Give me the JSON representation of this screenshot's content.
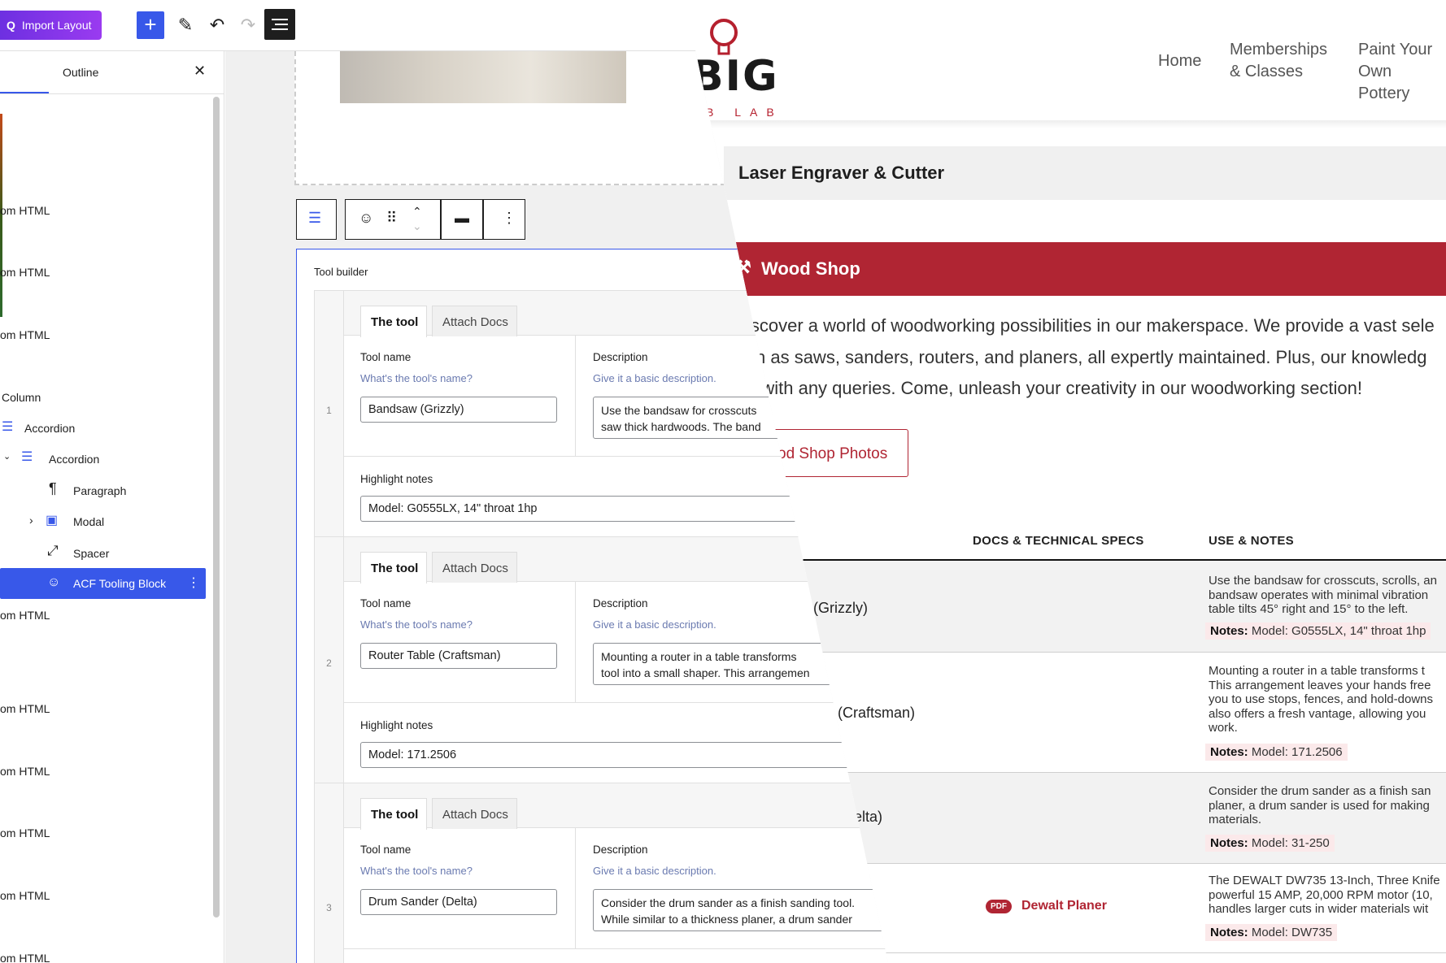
{
  "site": {
    "logo_text": "BIG",
    "logo_sub": "B LAB",
    "nav": [
      {
        "label": "Home"
      },
      {
        "label": "Memberships & Classes",
        "line1": "Memberships",
        "line2": "& Classes"
      },
      {
        "label": "Paint Your Own Pottery",
        "line1": "Paint Your",
        "line2": "Own Pottery"
      }
    ],
    "laser_title": "Laser Engraver & Cutter",
    "wood_title": "Wood Shop",
    "intro_lines": [
      "iscover a world of woodworking possibilities in our makerspace. We provide a vast sele",
      "ch as saws, sanders, routers, and planers, all expertly maintained. Plus, our knowledg",
      "o with any queries. Come, unleash your creativity in our woodworking section!"
    ],
    "photos_button": "od Shop Photos",
    "table": {
      "headers": {
        "docs": "DOCS & TECHNICAL SPECS",
        "use": "USE & NOTES"
      },
      "notes_label": "Notes:",
      "rows": [
        {
          "name": "(Grizzly)",
          "use": [
            "Use the bandsaw for crosscuts, scrolls, an",
            "bandsaw operates with minimal vibration",
            "table tilts 45° right and 15° to the left."
          ],
          "note": "Model: G0555LX, 14\" throat 1hp"
        },
        {
          "name": "(Craftsman)",
          "use": [
            "Mounting a router in a table transforms t",
            "This arrangement leaves your hands free",
            "you to use stops, fences, and hold-downs",
            "also offers a fresh vantage, allowing you",
            "work."
          ],
          "note": "Model: 171.2506"
        },
        {
          "name": "elta)",
          "use": [
            "Consider the drum sander as a finish san",
            "planer, a drum sander is used for making",
            "materials."
          ],
          "note": "Model: 31-250"
        },
        {
          "name": "",
          "doc_badge": "PDF",
          "doc_link": "Dewalt Planer",
          "use": [
            "The DEWALT DW735 13-Inch, Three Knife",
            "powerful 15 AMP, 20,000 RPM motor (10,",
            "handles larger cuts in wider materials wit"
          ],
          "note": "Model: DW735"
        }
      ]
    }
  },
  "editor": {
    "toolbar": {
      "import_label": "Import Layout",
      "import_icon": "Q",
      "add_icon": "+",
      "edit_icon": "✎",
      "undo_icon": "↶",
      "redo_icon": "↷"
    },
    "outline": {
      "title": "Outline",
      "close_icon": "✕",
      "items": [
        {
          "label": "om HTML"
        },
        {
          "label": "om HTML"
        },
        {
          "label": "om HTML"
        },
        {
          "label": "Column"
        },
        {
          "label": "Accordion"
        },
        {
          "label": "Accordion"
        },
        {
          "label": "Paragraph"
        },
        {
          "label": "Modal"
        },
        {
          "label": "Spacer"
        },
        {
          "label": "ACF Tooling Block"
        },
        {
          "label": "om HTML"
        },
        {
          "label": "om HTML"
        },
        {
          "label": "om HTML"
        },
        {
          "label": "om HTML"
        },
        {
          "label": "om HTML"
        },
        {
          "label": "om HTML"
        }
      ]
    },
    "block": {
      "title": "Tool builder",
      "tabs": {
        "tool": "The tool",
        "docs": "Attach Docs"
      },
      "labels": {
        "name": "Tool name",
        "name_hint": "What's the tool's name?",
        "desc": "Description",
        "desc_hint": "Give it a basic description.",
        "highlight": "Highlight notes"
      },
      "rows": [
        {
          "num": "1",
          "name": "Bandsaw (Grizzly)",
          "desc1": "Use the bandsaw for crosscuts",
          "desc2": "saw thick hardwoods. The band",
          "highlight": "Model: G0555LX, 14\" throat 1hp"
        },
        {
          "num": "2",
          "name": "Router Table (Craftsman)",
          "desc1": "Mounting a router in a table transforms",
          "desc2": "tool into a small shaper. This arrangemen",
          "highlight": "Model: 171.2506"
        },
        {
          "num": "3",
          "name": "Drum Sander (Delta)",
          "desc1": "Consider the drum sander as a finish sanding tool.",
          "desc2": "While similar to a thickness planer, a drum sander",
          "highlight": ""
        }
      ]
    }
  }
}
